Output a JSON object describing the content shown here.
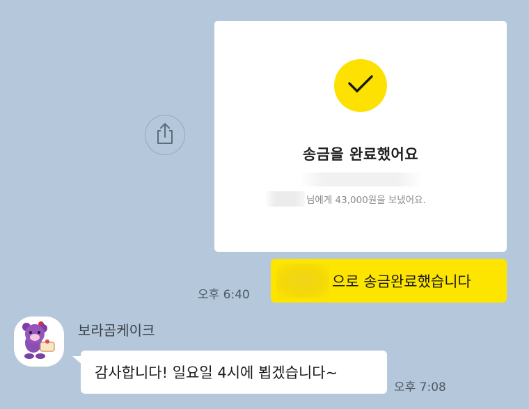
{
  "share_icon": "share-upload-icon",
  "transfer_card": {
    "check_icon": "checkmark-icon",
    "title": "송금을 완료했어요",
    "subtitle": "님에게 43,000원을 보냈어요.",
    "accent_color": "#fde101"
  },
  "sent_message": {
    "text": "으로 송금완료했습니다",
    "time": "오후 6:40",
    "bubble_color": "#fee500"
  },
  "received_message": {
    "sender": "보라곰케이크",
    "avatar_icon": "purple-bear-avatar",
    "text": "감사합니다! 일요일 4시에 뵙겠습니다~",
    "time": "오후 7:08"
  },
  "chat_background": "#b4c7db"
}
